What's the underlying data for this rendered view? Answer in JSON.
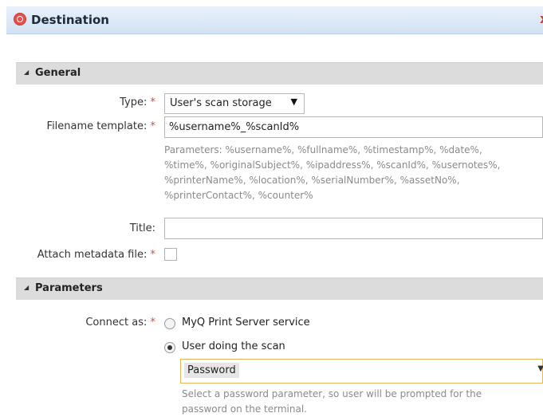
{
  "window": {
    "title": "Destination",
    "close_glyph": "x"
  },
  "general": {
    "heading": "General",
    "type_label": "Type:",
    "type_value": "User's scan storage",
    "filename_label": "Filename template:",
    "filename_value": "%username%_%scanId%",
    "params_line1": "Parameters: %username%, %fullname%, %timestamp%, %date%,",
    "params_line2": "%time%, %originalSubject%, %ipaddress%, %scanId%, %usernotes%,",
    "params_line3": "%printerName%, %location%, %serialNumber%, %assetNo%,",
    "params_line4": "%printerContact%, %counter%",
    "title_label": "Title:",
    "title_value": "",
    "attach_label": "Attach metadata file:",
    "attach_checked": false
  },
  "parameters": {
    "heading": "Parameters",
    "connect_label": "Connect as:",
    "option1": "MyQ Print Server service",
    "option2": "User doing the scan",
    "selected_option": "User doing the scan",
    "password_value": "Password",
    "help_line1": "Select a password parameter, so user will be prompted for the",
    "help_line2": "password on the terminal."
  },
  "required_marker": "*",
  "colors": {
    "accent": "#e2473f",
    "section_bg": "#dcdcdc",
    "titlebar": "#d3e2f4",
    "focus": "#e7b55a"
  },
  "icons": {
    "title": "destination-target-icon",
    "collapse": "triangle-collapse-icon",
    "dropdown": "caret-down-icon"
  }
}
